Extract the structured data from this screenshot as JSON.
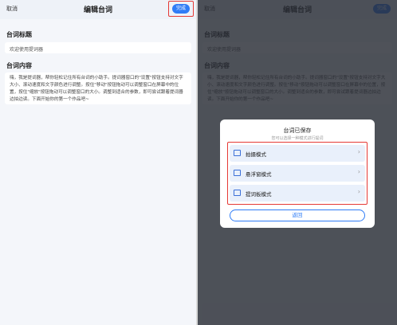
{
  "editor": {
    "cancel_label": "取消",
    "title": "编辑台词",
    "done_label": "完成",
    "title_section_label": "台词标题",
    "title_value": "欢迎使用提词器",
    "content_section_label": "台词内容",
    "content_value": "嗨，我是提词器，帮你轻松记住所有台词的小助手。提词器窗口的\"设置\"按钮支持对文字大小、滚动速度和文字颜色进行调整。按住\"移动\"按钮拖动可以调整窗口在屏幕中的位置，按住\"缩放\"按钮拖动可以调整窗口的大小。调整到适合的参数，即可尝试跟着提词器边拍边读。下面开始你的第一个作品吧~"
  },
  "dialog": {
    "title": "台词已保存",
    "subtitle": "您可以选择一种模式进行提词",
    "options": [
      {
        "label": "拍摄模式",
        "icon": "camera-mode-icon"
      },
      {
        "label": "悬浮窗模式",
        "icon": "floating-window-icon"
      },
      {
        "label": "提词板模式",
        "icon": "prompter-board-icon"
      }
    ],
    "return_label": "返回"
  },
  "colors": {
    "accent": "#2f7cf6",
    "highlight_outline": "#e53935"
  }
}
